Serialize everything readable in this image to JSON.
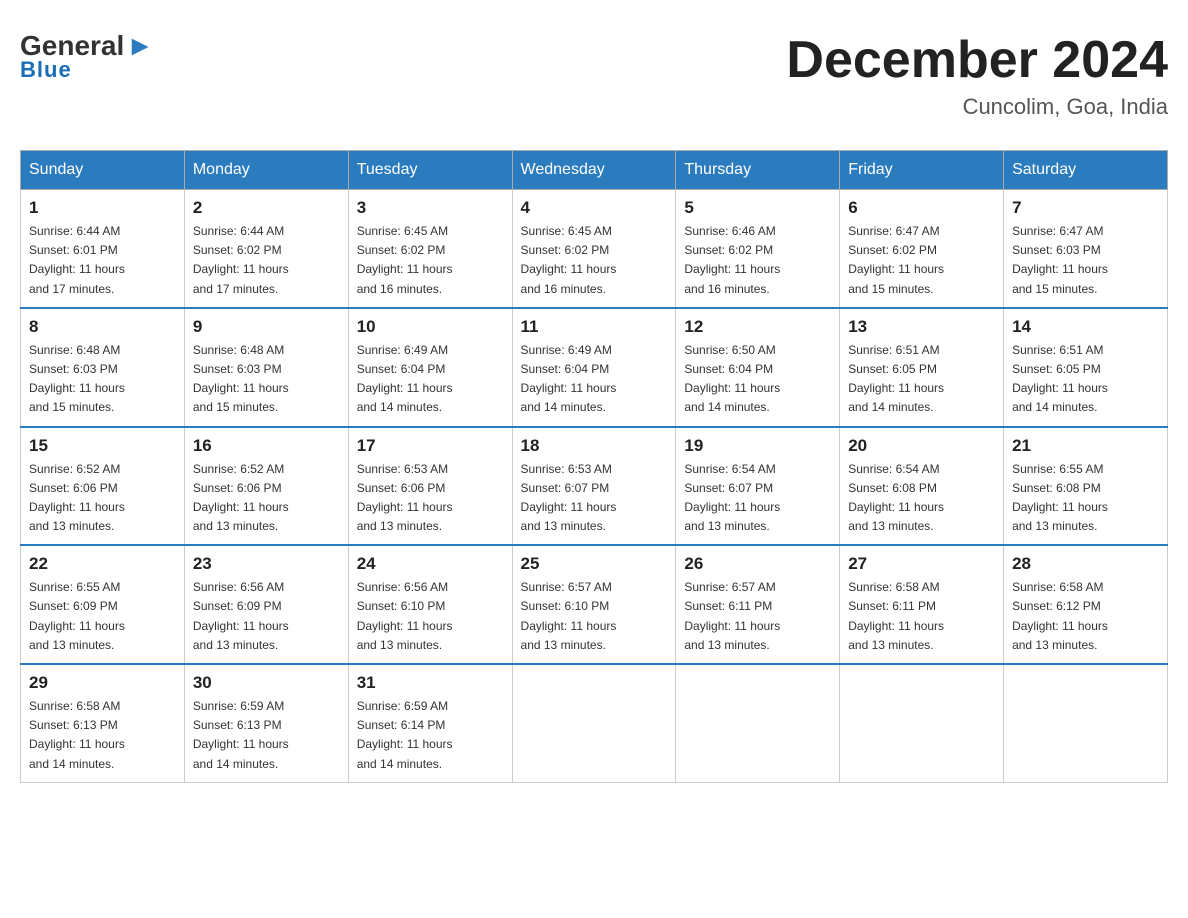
{
  "header": {
    "logo_general": "General",
    "logo_blue": "Blue",
    "main_title": "December 2024",
    "subtitle": "Cuncolim, Goa, India"
  },
  "days_of_week": [
    "Sunday",
    "Monday",
    "Tuesday",
    "Wednesday",
    "Thursday",
    "Friday",
    "Saturday"
  ],
  "weeks": [
    [
      {
        "day": "1",
        "sunrise": "6:44 AM",
        "sunset": "6:01 PM",
        "daylight": "11 hours and 17 minutes."
      },
      {
        "day": "2",
        "sunrise": "6:44 AM",
        "sunset": "6:02 PM",
        "daylight": "11 hours and 17 minutes."
      },
      {
        "day": "3",
        "sunrise": "6:45 AM",
        "sunset": "6:02 PM",
        "daylight": "11 hours and 16 minutes."
      },
      {
        "day": "4",
        "sunrise": "6:45 AM",
        "sunset": "6:02 PM",
        "daylight": "11 hours and 16 minutes."
      },
      {
        "day": "5",
        "sunrise": "6:46 AM",
        "sunset": "6:02 PM",
        "daylight": "11 hours and 16 minutes."
      },
      {
        "day": "6",
        "sunrise": "6:47 AM",
        "sunset": "6:02 PM",
        "daylight": "11 hours and 15 minutes."
      },
      {
        "day": "7",
        "sunrise": "6:47 AM",
        "sunset": "6:03 PM",
        "daylight": "11 hours and 15 minutes."
      }
    ],
    [
      {
        "day": "8",
        "sunrise": "6:48 AM",
        "sunset": "6:03 PM",
        "daylight": "11 hours and 15 minutes."
      },
      {
        "day": "9",
        "sunrise": "6:48 AM",
        "sunset": "6:03 PM",
        "daylight": "11 hours and 15 minutes."
      },
      {
        "day": "10",
        "sunrise": "6:49 AM",
        "sunset": "6:04 PM",
        "daylight": "11 hours and 14 minutes."
      },
      {
        "day": "11",
        "sunrise": "6:49 AM",
        "sunset": "6:04 PM",
        "daylight": "11 hours and 14 minutes."
      },
      {
        "day": "12",
        "sunrise": "6:50 AM",
        "sunset": "6:04 PM",
        "daylight": "11 hours and 14 minutes."
      },
      {
        "day": "13",
        "sunrise": "6:51 AM",
        "sunset": "6:05 PM",
        "daylight": "11 hours and 14 minutes."
      },
      {
        "day": "14",
        "sunrise": "6:51 AM",
        "sunset": "6:05 PM",
        "daylight": "11 hours and 14 minutes."
      }
    ],
    [
      {
        "day": "15",
        "sunrise": "6:52 AM",
        "sunset": "6:06 PM",
        "daylight": "11 hours and 13 minutes."
      },
      {
        "day": "16",
        "sunrise": "6:52 AM",
        "sunset": "6:06 PM",
        "daylight": "11 hours and 13 minutes."
      },
      {
        "day": "17",
        "sunrise": "6:53 AM",
        "sunset": "6:06 PM",
        "daylight": "11 hours and 13 minutes."
      },
      {
        "day": "18",
        "sunrise": "6:53 AM",
        "sunset": "6:07 PM",
        "daylight": "11 hours and 13 minutes."
      },
      {
        "day": "19",
        "sunrise": "6:54 AM",
        "sunset": "6:07 PM",
        "daylight": "11 hours and 13 minutes."
      },
      {
        "day": "20",
        "sunrise": "6:54 AM",
        "sunset": "6:08 PM",
        "daylight": "11 hours and 13 minutes."
      },
      {
        "day": "21",
        "sunrise": "6:55 AM",
        "sunset": "6:08 PM",
        "daylight": "11 hours and 13 minutes."
      }
    ],
    [
      {
        "day": "22",
        "sunrise": "6:55 AM",
        "sunset": "6:09 PM",
        "daylight": "11 hours and 13 minutes."
      },
      {
        "day": "23",
        "sunrise": "6:56 AM",
        "sunset": "6:09 PM",
        "daylight": "11 hours and 13 minutes."
      },
      {
        "day": "24",
        "sunrise": "6:56 AM",
        "sunset": "6:10 PM",
        "daylight": "11 hours and 13 minutes."
      },
      {
        "day": "25",
        "sunrise": "6:57 AM",
        "sunset": "6:10 PM",
        "daylight": "11 hours and 13 minutes."
      },
      {
        "day": "26",
        "sunrise": "6:57 AM",
        "sunset": "6:11 PM",
        "daylight": "11 hours and 13 minutes."
      },
      {
        "day": "27",
        "sunrise": "6:58 AM",
        "sunset": "6:11 PM",
        "daylight": "11 hours and 13 minutes."
      },
      {
        "day": "28",
        "sunrise": "6:58 AM",
        "sunset": "6:12 PM",
        "daylight": "11 hours and 13 minutes."
      }
    ],
    [
      {
        "day": "29",
        "sunrise": "6:58 AM",
        "sunset": "6:13 PM",
        "daylight": "11 hours and 14 minutes."
      },
      {
        "day": "30",
        "sunrise": "6:59 AM",
        "sunset": "6:13 PM",
        "daylight": "11 hours and 14 minutes."
      },
      {
        "day": "31",
        "sunrise": "6:59 AM",
        "sunset": "6:14 PM",
        "daylight": "11 hours and 14 minutes."
      },
      null,
      null,
      null,
      null
    ]
  ],
  "labels": {
    "sunrise": "Sunrise:",
    "sunset": "Sunset:",
    "daylight": "Daylight:"
  }
}
